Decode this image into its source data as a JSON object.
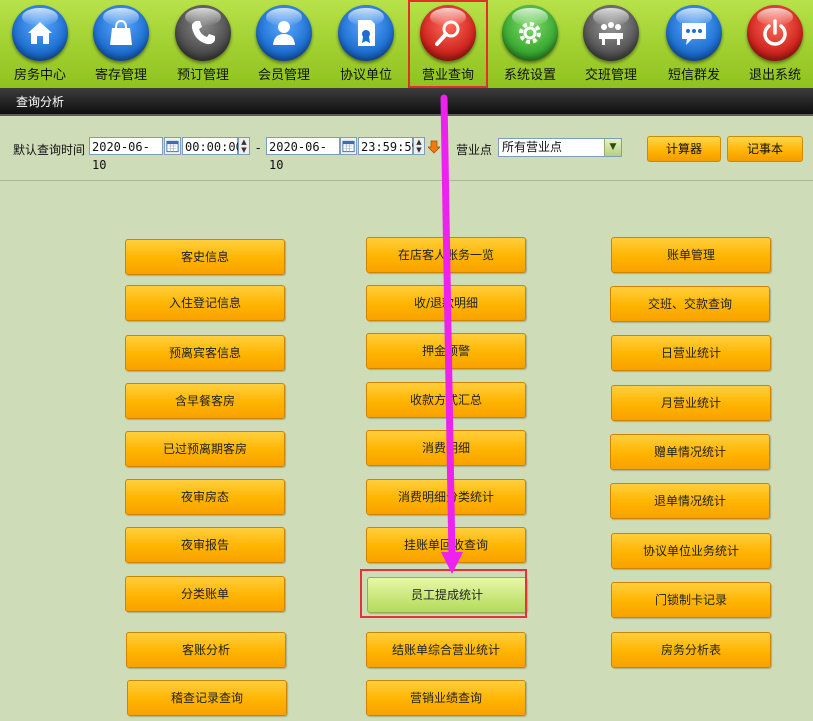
{
  "nav": [
    {
      "label": "房务中心",
      "icon": "house-icon",
      "color": "#1e6fd0"
    },
    {
      "label": "寄存管理",
      "icon": "bag-icon",
      "color": "#1e6fd0"
    },
    {
      "label": "预订管理",
      "icon": "phone-icon",
      "color": "#4d4d4d"
    },
    {
      "label": "会员管理",
      "icon": "person-icon",
      "color": "#1e6fd0"
    },
    {
      "label": "协议单位",
      "icon": "certificate-icon",
      "color": "#1e6fd0"
    },
    {
      "label": "营业查询",
      "icon": "magnifier-icon",
      "color": "#d0261f",
      "active": true
    },
    {
      "label": "系统设置",
      "icon": "gear-icon",
      "color": "#3aa832"
    },
    {
      "label": "交班管理",
      "icon": "meeting-icon",
      "color": "#555555"
    },
    {
      "label": "短信群发",
      "icon": "message-icon",
      "color": "#1e6fd0"
    },
    {
      "label": "退出系统",
      "icon": "power-icon",
      "color": "#d0261f"
    }
  ],
  "title": "查询分析",
  "filter": {
    "default_time_label": "默认查询时间",
    "start_date": "2020-06-10",
    "start_time": "00:00:00",
    "dash": "-",
    "end_date": "2020-06-10",
    "end_time": "23:59:59",
    "outlet_label": "营业点",
    "outlet_value": "所有营业点",
    "calculator_label": "计算器",
    "notepad_label": "记事本"
  },
  "columns": {
    "left": [
      "客史信息",
      "入住登记信息",
      "预离宾客信息",
      "含早餐客房",
      "已过预离期客房",
      "夜审房态",
      "夜审报告",
      "分类账单",
      "客账分析",
      "稽查记录查询"
    ],
    "middle": [
      "在店客人账务一览",
      "收/退款明细",
      "押金预警",
      "收款方式汇总",
      "消费明细",
      "消费明细分类统计",
      "挂账单回收查询",
      "员工提成统计",
      "结账单综合营业统计",
      "营销业绩查询"
    ],
    "right": [
      "账单管理",
      "交班、交款查询",
      "日营业统计",
      "月营业统计",
      "赠单情况统计",
      "退单情况统计",
      "协议单位业务统计",
      "门锁制卡记录",
      "房务分析表"
    ]
  },
  "highlighted_item": "员工提成统计",
  "colors": {
    "accent": "#e8303a",
    "arrow": "#ee22ee",
    "button": "#ffb400"
  }
}
